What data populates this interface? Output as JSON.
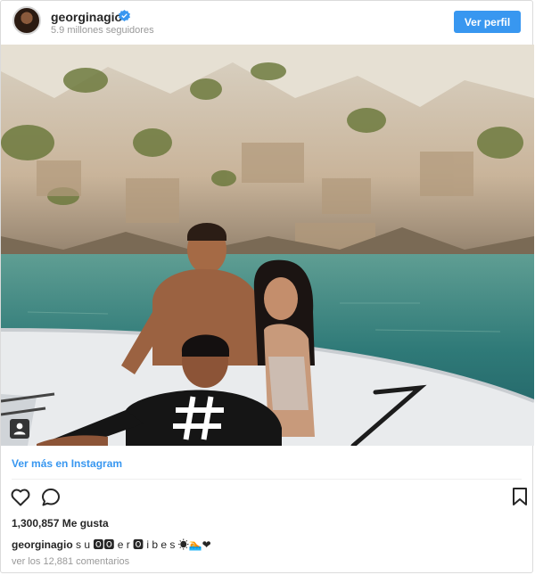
{
  "header": {
    "username": "georginagio",
    "followers": "5.9 millones seguidores",
    "view_profile_label": "Ver perfil"
  },
  "post": {
    "view_more_label": "Ver más en Instagram",
    "likes": "1,300,857 Me gusta",
    "caption_user": "georginagio",
    "caption_text": "s u 🅾🅾 e r 🅾 i b e s ☀🏊❤",
    "comments": "ver los 12,881 comentarios"
  },
  "icons": {
    "verified": "verified-badge-icon",
    "like": "heart-icon",
    "comment": "comment-bubble-icon",
    "save": "bookmark-icon",
    "tag": "user-tag-icon"
  },
  "colors": {
    "accent": "#3897f0",
    "text": "#262626",
    "muted": "#999999",
    "border": "#dbdbdb"
  }
}
